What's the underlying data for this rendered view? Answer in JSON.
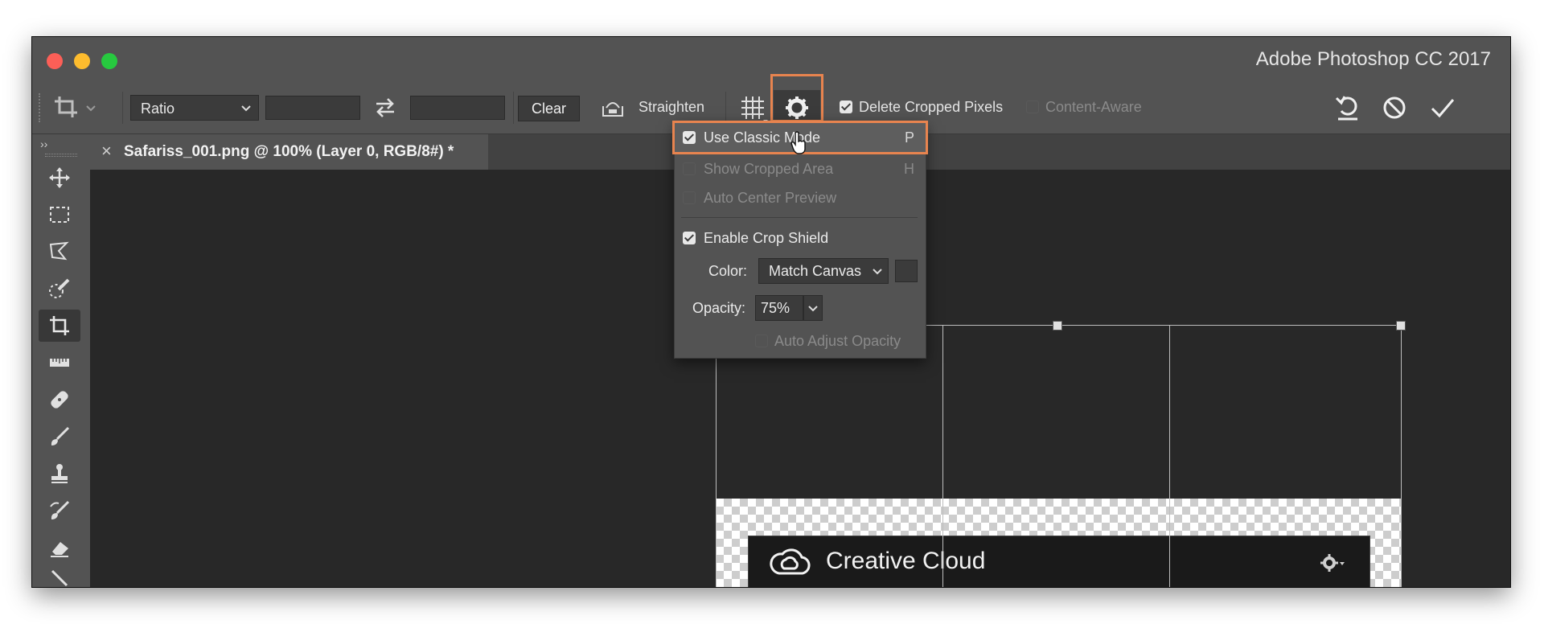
{
  "window": {
    "title": "Adobe Photoshop CC 2017"
  },
  "options_bar": {
    "ratio_select": "Ratio",
    "clear_label": "Clear",
    "straighten_label": "Straighten",
    "delete_cropped_label": "Delete Cropped Pixels",
    "delete_cropped_checked": true,
    "content_aware_label": "Content-Aware",
    "content_aware_checked": false
  },
  "document": {
    "tab_title": "Safariss_001.png @ 100% (Layer 0, RGB/8#) *"
  },
  "tools": [
    "move-icon",
    "marquee-icon",
    "lasso-icon",
    "quick-selection-icon",
    "crop-icon",
    "ruler-icon",
    "healing-brush-icon",
    "brush-icon",
    "clone-stamp-icon",
    "history-brush-icon",
    "eraser-icon",
    "gradient-icon"
  ],
  "crop_settings_menu": {
    "use_classic_mode": {
      "label": "Use Classic Mode",
      "shortcut": "P",
      "checked": true
    },
    "show_cropped_area": {
      "label": "Show Cropped Area",
      "shortcut": "H",
      "checked": false
    },
    "auto_center_preview": {
      "label": "Auto Center Preview",
      "checked": false
    },
    "enable_crop_shield": {
      "label": "Enable Crop Shield",
      "checked": true
    },
    "color": {
      "label": "Color:",
      "value": "Match Canvas"
    },
    "opacity": {
      "label": "Opacity:",
      "value": "75%"
    },
    "auto_adjust_opacity": {
      "label": "Auto Adjust Opacity",
      "checked": false
    }
  },
  "canvas_content": {
    "app_title": "Creative Cloud"
  },
  "colors": {
    "accent_highlight": "#e8844f",
    "panel": "#535353",
    "canvas": "#282828"
  }
}
